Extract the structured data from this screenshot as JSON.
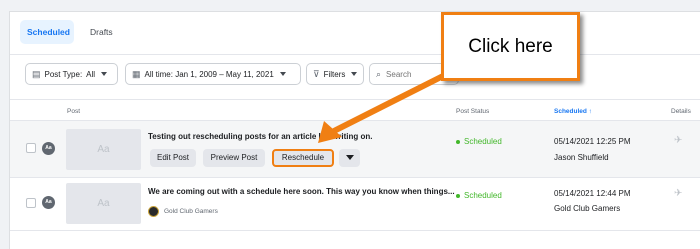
{
  "tabs": {
    "scheduled": "Scheduled",
    "drafts": "Drafts"
  },
  "filters": {
    "post_type_label": "Post Type:",
    "post_type_value": "All",
    "date_range": "All time: Jan 1, 2009 – May 11, 2021",
    "filters_label": "Filters",
    "search_placeholder": "Search"
  },
  "table": {
    "headers": {
      "post": "Post",
      "status": "Post Status",
      "scheduled": "Scheduled ↑",
      "details": "Details"
    },
    "rows": [
      {
        "title": "Testing out rescheduling posts for an article I'm writing on.",
        "thumb": "Aa",
        "badge": "Aa",
        "buttons": {
          "edit": "Edit Post",
          "preview": "Preview Post",
          "reschedule": "Reschedule"
        },
        "status": "Scheduled",
        "date": "05/14/2021 12:25 PM",
        "author": "Jason Shuffield"
      },
      {
        "title": "We are coming out with a schedule here soon. This way you know when things...",
        "thumb": "Aa",
        "badge": "Aa",
        "page_name": "Gold Club Gamers",
        "status": "Scheduled",
        "date": "05/14/2021 12:44 PM",
        "author": "Gold Club Gamers"
      }
    ]
  },
  "callout": {
    "text": "Click here"
  },
  "colors": {
    "accent": "#1877f2",
    "status_green": "#42b72a",
    "callout_orange": "#f07f13"
  },
  "icons": {
    "post_type": "post-type-icon",
    "calendar": "calendar-icon",
    "filter": "filter-icon",
    "search": "search-icon",
    "details": "rocket-icon",
    "dropdown": "chevron-down-icon"
  }
}
